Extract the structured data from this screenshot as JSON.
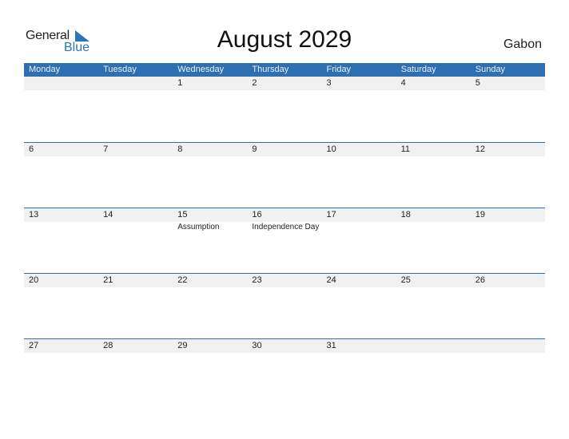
{
  "logo": {
    "line1": "General",
    "line2": "Blue",
    "accent_color": "#2a76bb"
  },
  "title": "August 2029",
  "country": "Gabon",
  "colors": {
    "header_bg": "#2e6fb2",
    "date_row_bg": "#f1f1f1"
  },
  "weekdays": [
    "Monday",
    "Tuesday",
    "Wednesday",
    "Thursday",
    "Friday",
    "Saturday",
    "Sunday"
  ],
  "weeks": [
    {
      "days": [
        "",
        "",
        "1",
        "2",
        "3",
        "4",
        "5"
      ],
      "events": [
        "",
        "",
        "",
        "",
        "",
        "",
        ""
      ]
    },
    {
      "days": [
        "6",
        "7",
        "8",
        "9",
        "10",
        "11",
        "12"
      ],
      "events": [
        "",
        "",
        "",
        "",
        "",
        "",
        ""
      ]
    },
    {
      "days": [
        "13",
        "14",
        "15",
        "16",
        "17",
        "18",
        "19"
      ],
      "events": [
        "",
        "",
        "Assumption",
        "Independence Day",
        "",
        "",
        ""
      ]
    },
    {
      "days": [
        "20",
        "21",
        "22",
        "23",
        "24",
        "25",
        "26"
      ],
      "events": [
        "",
        "",
        "",
        "",
        "",
        "",
        ""
      ]
    },
    {
      "days": [
        "27",
        "28",
        "29",
        "30",
        "31",
        "",
        ""
      ],
      "events": [
        "",
        "",
        "",
        "",
        "",
        "",
        ""
      ]
    }
  ]
}
